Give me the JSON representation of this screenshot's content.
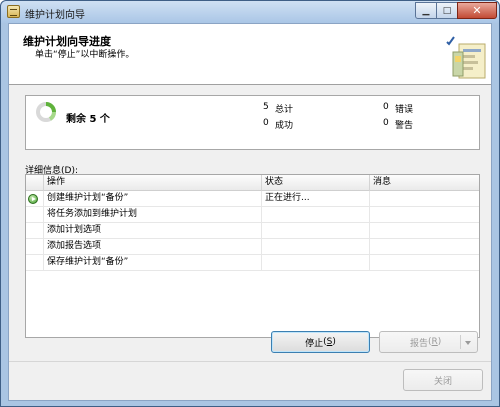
{
  "window": {
    "title": "维护计划向导",
    "controls": {
      "minimize": "▁",
      "maximize": "□",
      "close": "✕"
    }
  },
  "header": {
    "title": "维护计划向导进度",
    "subtitle": "单击“停止”以中断操作。",
    "art_icon": "wizard-illustration-icon"
  },
  "summary": {
    "remaining": "剩余 5 个",
    "total_count": "5",
    "total_label": "总计",
    "success_count": "0",
    "success_label": "成功",
    "error_count": "0",
    "error_label": "错误",
    "warning_count": "0",
    "warning_label": "警告",
    "progress_icon": "spinner-icon"
  },
  "details": {
    "label": "详细信息",
    "accelerator": "D",
    "columns": [
      "操作",
      "状态",
      "消息"
    ],
    "rows": [
      {
        "action": "创建维护计划“备份”",
        "status": "正在进行...",
        "message": "",
        "icon": "running-icon"
      },
      {
        "action": "将任务添加到维护计划",
        "status": "",
        "message": ""
      },
      {
        "action": "添加计划选项",
        "status": "",
        "message": ""
      },
      {
        "action": "添加报告选项",
        "status": "",
        "message": ""
      },
      {
        "action": "保存维护计划“备份”",
        "status": "",
        "message": ""
      }
    ]
  },
  "buttons": {
    "stop_label": "停止",
    "stop_accel": "S",
    "report_label": "报告",
    "report_accel": "R",
    "close_label": "关闭"
  },
  "colors": {
    "titlebar": "#aac6e6",
    "close_button": "#c24a34",
    "running_icon": "#3f9d2a",
    "focus_border": "#3c7fb1"
  }
}
